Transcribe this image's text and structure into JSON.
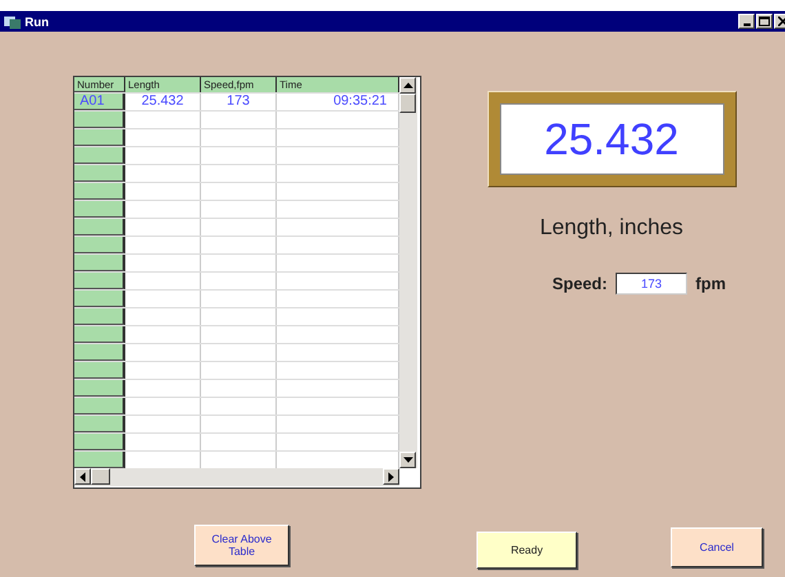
{
  "window": {
    "title": "Run"
  },
  "table": {
    "columns": [
      "Number",
      "Length",
      "Speed,fpm",
      "Time"
    ],
    "rows": [
      {
        "number": "A01",
        "length": "25.432",
        "speed": "173",
        "time": "09:35:21"
      }
    ]
  },
  "display": {
    "value": "25.432",
    "caption": "Length, inches"
  },
  "speed": {
    "label": "Speed:",
    "value": "173",
    "unit": "fpm"
  },
  "buttons": [
    {
      "label": "Clear Above Table",
      "kind": "clear"
    },
    {
      "label": "Ready",
      "kind": "ready"
    },
    {
      "label": "Cancel",
      "kind": "cancel"
    }
  ]
}
